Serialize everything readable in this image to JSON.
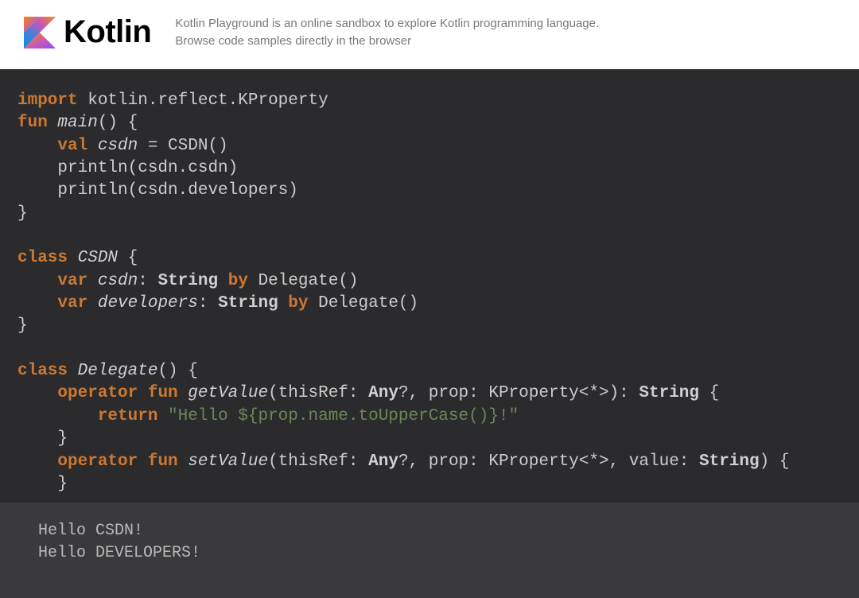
{
  "header": {
    "brand": "Kotlin",
    "description": "Kotlin Playground is an online sandbox to explore Kotlin programming language. Browse code samples directly in the browser"
  },
  "code": {
    "l1_kw": "import",
    "l1_rest": " kotlin.reflect.KProperty",
    "l2_kw": "fun",
    "l2_name": " main",
    "l2_rest": "() {",
    "l3_kw": "val",
    "l3_name": " csdn",
    "l3_rest": " = CSDN()",
    "l4": "    println(csdn.csdn)",
    "l5": "    println(csdn.developers)",
    "l6": "}",
    "l7": "",
    "l8_kw": "class",
    "l8_name": " CSDN",
    "l8_rest": " {",
    "l9_kw1": "var",
    "l9_name": " csdn",
    "l9_colon": ": ",
    "l9_type": "String",
    "l9_by": " by",
    "l9_rest": " Delegate()",
    "l10_kw1": "var",
    "l10_name": " developers",
    "l10_colon": ": ",
    "l10_type": "String",
    "l10_by": " by",
    "l10_rest": " Delegate()",
    "l11": "}",
    "l12": "",
    "l13_kw": "class",
    "l13_name": " Delegate",
    "l13_rest": "() {",
    "l14_kw1": "operator",
    "l14_kw2": " fun",
    "l14_name": " getValue",
    "l14_p1": "(thisRef: ",
    "l14_any": "Any",
    "l14_p2": "?, prop: KProperty<*>): ",
    "l14_ret": "String",
    "l14_p3": " {",
    "l15_kw": "return",
    "l15_str": " \"Hello ${prop.name.toUpperCase()}!\"",
    "l16": "    }",
    "l17_kw1": "operator",
    "l17_kw2": " fun",
    "l17_name": " setValue",
    "l17_p1": "(thisRef: ",
    "l17_any": "Any",
    "l17_p2": "?, prop: KProperty<*>, value: ",
    "l17_vt": "String",
    "l17_p3": ") {",
    "l18": "    }"
  },
  "output": {
    "line1": "Hello CSDN!",
    "line2": "Hello DEVELOPERS!"
  }
}
